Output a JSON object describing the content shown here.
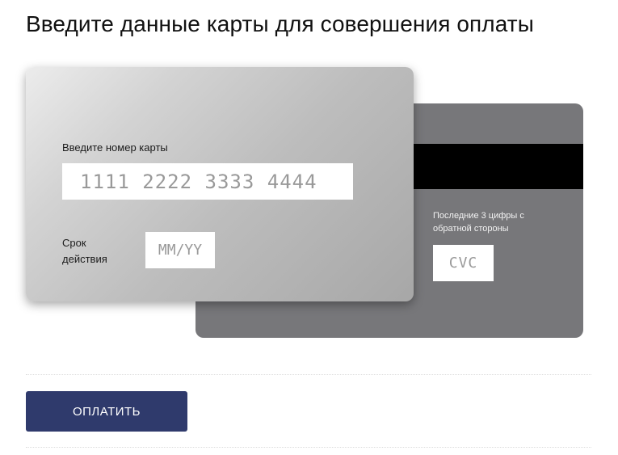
{
  "page": {
    "title": "Введите данные карты для совершения оплаты"
  },
  "card_front": {
    "number_label": "Введите номер карты",
    "number_placeholder": "1111 2222 3333 4444",
    "expiry_label": "Срок действия",
    "expiry_placeholder": "MM/YY"
  },
  "card_back": {
    "cvc_label": "Последние 3 цифры с обратной стороны",
    "cvc_placeholder": "CVC"
  },
  "actions": {
    "pay_label": "ОПЛАТИТЬ"
  },
  "colors": {
    "button": "#2f3a6c",
    "back_card": "#77777a",
    "stripe": "#000000"
  }
}
